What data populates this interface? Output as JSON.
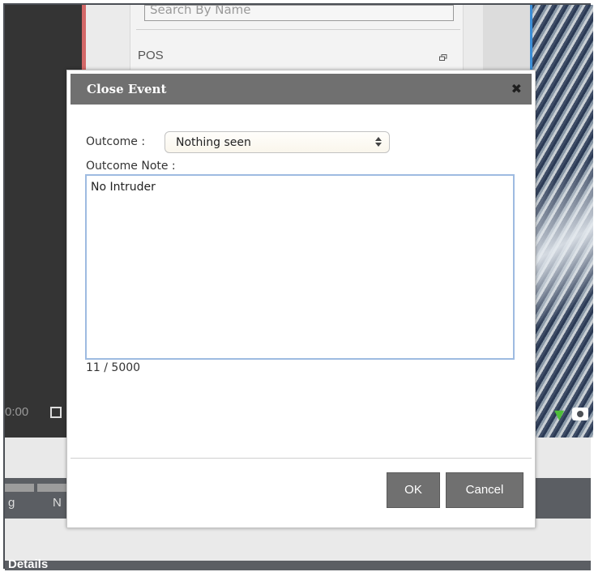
{
  "background": {
    "search_placeholder": "Search By Name",
    "section_title": "POS",
    "time_fragment": "0:00",
    "tab_fragment_1": "g",
    "tab_fragment_2": "N",
    "details_label": "Details"
  },
  "dialog": {
    "title": "Close Event",
    "close_glyph": "✖",
    "outcome_label": "Outcome :",
    "outcome_selected": "Nothing seen",
    "note_label": "Outcome Note :",
    "note_value": "No Intruder",
    "char_count": "11 / 5000",
    "ok_label": "OK",
    "cancel_label": "Cancel"
  },
  "icons": {
    "restore": "restore-window-icon",
    "list": "list-icon",
    "camera": "camera-icon",
    "chat": "chat-icon"
  },
  "colors": {
    "header": "#707070",
    "button": "#707070",
    "textarea_border": "#9ebbe1",
    "camera_selection": "#3a8dd6",
    "red_divider": "#d36868"
  }
}
